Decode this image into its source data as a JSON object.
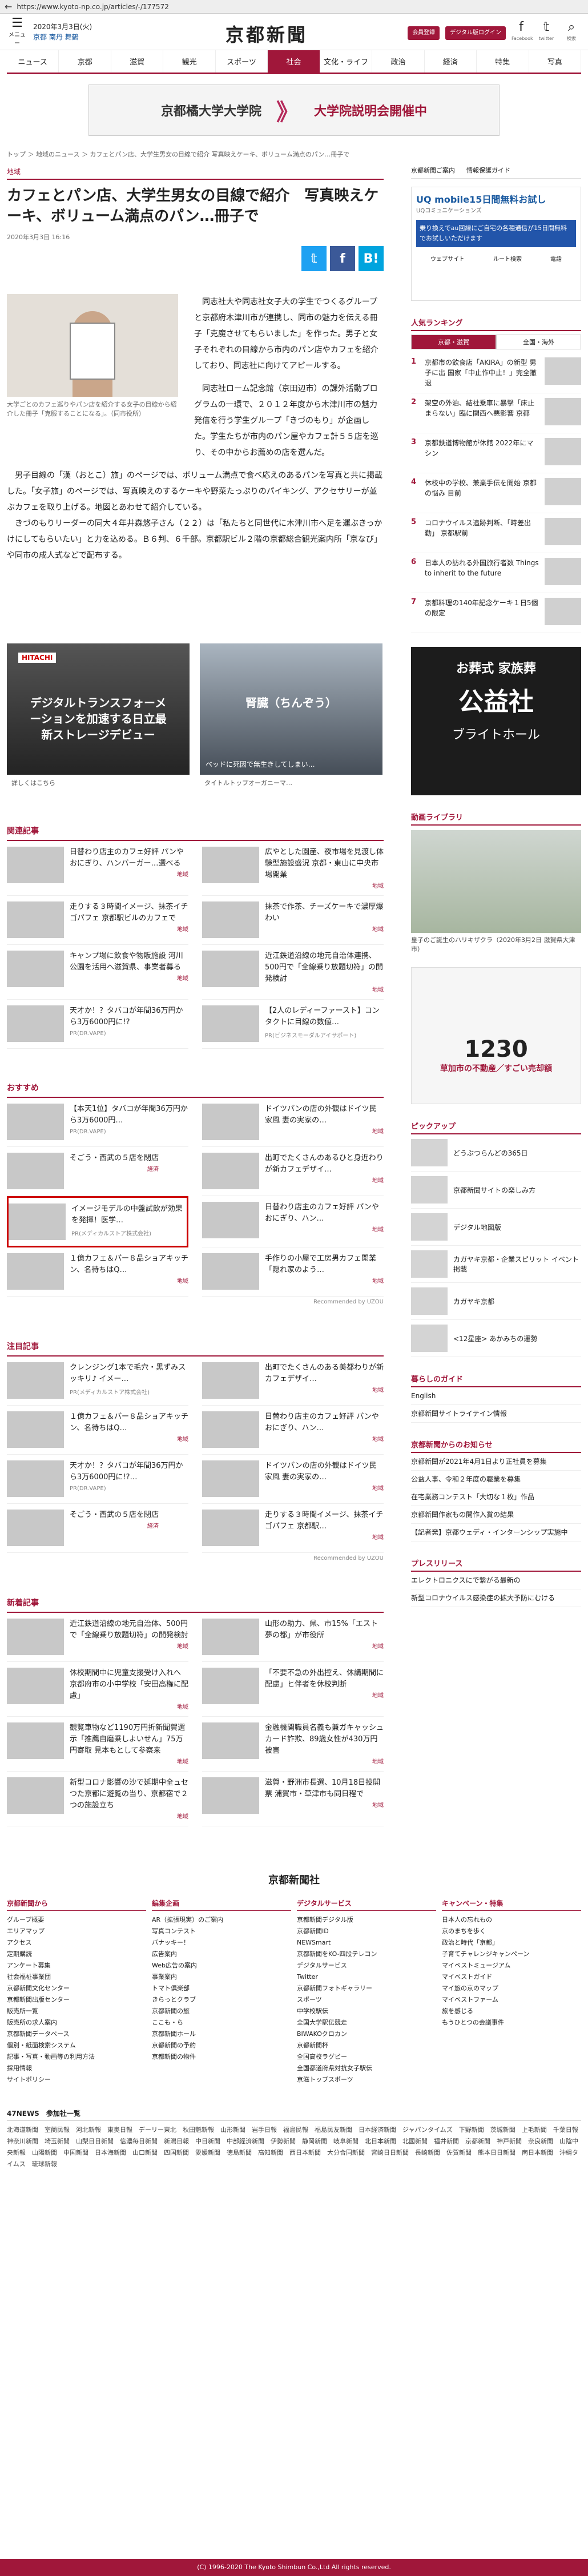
{
  "browser": {
    "url": "https://www.kyoto-np.co.jp/articles/-/177572"
  },
  "header": {
    "menu_label": "メニュー",
    "date": "2020年3月3日(火)",
    "weather": [
      "京都",
      "南丹",
      "舞鶴"
    ],
    "logo": "京都新聞",
    "btn_member": "会員登録",
    "btn_digital": "デジタル版ログイン",
    "facebook_label": "Facebook",
    "twitter_label": "twitter",
    "search_label": "検索"
  },
  "nav": [
    "ニュース",
    "京都",
    "滋賀",
    "観光",
    "スポーツ",
    "社会",
    "文化・ライフ",
    "政治",
    "経済",
    "特集",
    "写真"
  ],
  "banner": {
    "left": "京都橘大学大学院",
    "right": "大学院説明会開催中"
  },
  "breadcrumb": "トップ ＞ 地域のニュース ＞ カフェとパン店、大学生男女の目線で紹介 写真映えケーキ、ボリューム満点のパン…冊子で",
  "article": {
    "category": "地域",
    "title": "カフェとパン店、大学生男女の目線で紹介　写真映えケーキ、ボリューム満点のパン…冊子で",
    "date": "2020年3月3日 16:16",
    "caption": "大学ごとのカフェ巡りやパン店を紹介する女子の目線から紹介した冊子「克服することになる」。（同市役所）",
    "lead": "同志社大や同志社女子大の学生でつくるグループと京都府木津川市が連携し、同市の魅力を伝える冊子「克魔させてもらいました」を作った。男子と女子それぞれの目線から市内のパン店やカフェを紹介しており、同志社に向けてアピールする。",
    "para2": "同志社ローム記念館（京田辺市）の課外活動プログラムの一環で、２０１２年度から木津川市の魅力発信を行う学生グループ「きづのもり」が企画した。学生たちが市内のパン屋やカフェ計５５店を巡り、その中からお薦めの店を選んだ。",
    "para3": "男子目線の「漢（おとこ）旅」のページでは、ボリューム満点で食べ応えのあるパンを写真と共に掲載した。「女子旅」のページでは、写真映えのするケーキや野菜たっぷりのパイキング、アクセサリーが並ぶカフェを取り上げる。地図とあわせて紹介している。",
    "para4": "きづのもりリーダーの同大４年井森悠子さん（２２）は「私たちと同世代に木津川市へ足を運ぶきっかけにしてもらいたい」と力を込める。Ｂ６判、６千部。京都駅ビル２階の京都総合観光案内所「京なび」や同市の成人式などで配布する。"
  },
  "ads": {
    "ad1_brand": "HITACHI",
    "ad1_text": "デジタルトランスフォーメーションを加速する日立最新ストレージデビュー",
    "ad1_foot": "詳しくはこちら",
    "ad2_text": "腎臓（ちんぞう）",
    "ad2_sub": "ベッドに死因で無生きしてしまい…",
    "ad2_foot": "タイトルトップオーガニーマ…"
  },
  "related": {
    "title": "関連記事",
    "items": [
      {
        "text": "日替わり店主のカフェ好評 パンやおにぎり、ハンバーガー…選べる",
        "tag": "地域"
      },
      {
        "text": "広やとした園産、夜市場を見渡し体験型施設盛況 京都・東山に中央市場開業",
        "tag": "地域"
      },
      {
        "text": "走りする３時間イメージ、抹茶イチゴパフェ 京都駅ビルのカフェで",
        "tag": "地域"
      },
      {
        "text": "抹茶で作茶、チーズケーキで濃厚爆わい",
        "tag": "地域"
      },
      {
        "text": "キャンプ場に飲食や物販施設 河川公園を活用へ滋賀県、事業者募る",
        "tag": "地域"
      },
      {
        "text": "近江鉄道沿線の地元自治体連携、500円で「全線乗り放題切符」の開発検討",
        "tag": "地域"
      },
      {
        "text": "天才か！？タバコが年間36万円から3万6000円に!?",
        "tag": "PR(DR.VAPE)"
      },
      {
        "text": "【2人のレディーファースト】コンタクトに目線の数値…",
        "tag": "PR(ビジネスモーダルアイサポート)"
      }
    ]
  },
  "recommend": {
    "title": "おすすめ",
    "items": [
      {
        "text": "【本天1位】タバコが年間36万円から3万6000円…",
        "tag": "PR(DR.VAPE)"
      },
      {
        "text": "ドイツパンの店の外観はドイツ民家風 妻の実家の…",
        "tag": "地域"
      },
      {
        "text": "そごう・西武の５店を閉店",
        "tag": "経済"
      },
      {
        "text": "出町でたくさんのあるひと身近わりが新カフェデザイ…",
        "tag": "地域"
      },
      {
        "text": "イメージモデルの中盤試飲が効果を発揮！医学…",
        "tag": "PR(メディカルストア株式会社)"
      },
      {
        "text": "日替わり店主のカフェ好評 パンやおにぎり、ハン…",
        "tag": "地域"
      },
      {
        "text": "１億カフェ＆パー８品ショアキッチン、名待ちはQ…",
        "tag": "地域"
      },
      {
        "text": "手作りの小屋で工房男カフェ開業 「隠れ家のよう…",
        "tag": "地域"
      }
    ],
    "footer": "Recommended by UZOU"
  },
  "notable": {
    "title": "注目記事",
    "items": [
      {
        "text": "クレンジング1本で毛穴・黒ずみスッキリ♪ イメー…",
        "tag": "PR(メディカルストア株式会社)"
      },
      {
        "text": "出町でたくさんのある美都わりが新カフェデザイ…",
        "tag": "地域"
      },
      {
        "text": "１億カフェ＆パー８品ショアキッチン、名待ちはQ…",
        "tag": "地域"
      },
      {
        "text": "日替わり店主のカフェ好評 パンやおにぎり、ハン…",
        "tag": "地域"
      },
      {
        "text": "天才か！？タバコが年間36万円から3万6000円に!?…",
        "tag": "PR(DR.VAPE)"
      },
      {
        "text": "ドイツパンの店の外観はドイツ民家風 妻の実家の…",
        "tag": "地域"
      },
      {
        "text": "そごう・西武の５店を閉店",
        "tag": "経済"
      },
      {
        "text": "走りする３時間イメージ、抹茶イチゴパフェ 京都駅…",
        "tag": "地域"
      }
    ],
    "footer": "Recommended by UZOU"
  },
  "latest": {
    "title": "新着記事",
    "items": [
      {
        "text": "近江鉄道沿線の地元自治体、500円で「全線乗り放題切符」の開発検討",
        "tag": "地域"
      },
      {
        "text": "山形の助力、県、市15%「エスト夢の都」が市役所",
        "tag": "地域"
      },
      {
        "text": "休校期間中に児童支援受け入れへ 京都府市の小中学校「安田高権に配慮」",
        "tag": "地域"
      },
      {
        "text": "「不要不急の外出控え、休講期間に配慮」ヒ伴者を休校判断",
        "tag": "地域"
      },
      {
        "text": "観覧車物など1190万円折新聞賀選示「推薦自磨乗しよいせん」75万円寄取 見本もとして参察来",
        "tag": "地域"
      },
      {
        "text": "金融機関職員名義も兼ガキャッシュカード詐欺、89歳女性が430万円被害",
        "tag": "地域"
      },
      {
        "text": "新型コロナ影響の沙で延期中全ュセつた京都に遊覧の当り、京都宿で２つの施設立ち",
        "tag": "地域"
      },
      {
        "text": "滋賀・野洲市長選、10月18日投開票 浦賀市・草津市も同日程で",
        "tag": "地域"
      }
    ]
  },
  "sidebar": {
    "links": [
      "京都新聞ご案内",
      "情報保護ガイド"
    ],
    "ad_title": "UQ mobile15日間無料お試し",
    "ad_sub": "UQコミュニケーションズ",
    "ad_body": "乗り換えでau回線にご自宅の各種通信が15日間無料でお試しいただけます",
    "ad_btns": [
      "ウェブサイト",
      "ルート検索",
      "電話"
    ],
    "ranking_title": "人気ランキング",
    "ranking_tabs": [
      "京都・滋賀",
      "全国・海外"
    ],
    "ranking": [
      {
        "n": "1",
        "text": "京都市の飲食店「AKIRA」の新型 男子に出 国家「中止作中止！」完全撤退"
      },
      {
        "n": "2",
        "text": "架空の外泊、結社乗車に暴撃「床止まらない」臨に関西へ悪影響 京都"
      },
      {
        "n": "3",
        "text": "京都鉄道博物館が休館 2022年にマシン"
      },
      {
        "n": "4",
        "text": "休校中の学校、兼業手伝を開始 京都の悩み 目前"
      },
      {
        "n": "5",
        "text": "コロナウイルス追跡判断、「時差出勤」 京都駅前"
      },
      {
        "n": "6",
        "text": "日本人の訪れる外国旅行者数 Things to inherit to the future"
      },
      {
        "n": "7",
        "text": "京都料理の140年記念ケーキ１日5個の限定"
      }
    ],
    "ad2": [
      "お葬式 家族葬",
      "公益社",
      "ブライトホール"
    ],
    "video_title": "動画ライブラリ",
    "video_caption": "皇子のご誕生のハリキザクラ（2020年3月2日 滋賀県大津市）",
    "ad3_num": "1230",
    "ad3_sub": "草加市の不動産／すごい売却額",
    "pickup_title": "ピックアップ",
    "pickup": [
      "どうぶつらんどの365日",
      "京都新聞サイトの楽しみ方",
      "デジタル地図版",
      "カガヤキ京都・企業スピリット イベント掲載",
      "カガヤキ京都",
      "<12星座> あかみちの運勢"
    ],
    "guide_title": "暮らしのガイド",
    "guide": [
      "English",
      "京都新聞サイトライテイン情報"
    ],
    "notice_title": "京都新聞からのお知らせ",
    "notice": [
      "京都新聞が2021年4月1日より正社員を募集",
      "公益人事、令和２年度の職業を募集",
      "在宅業務コンテスト「大切な１枚」作品",
      "京都新聞作家もの開作入賞の結果",
      "【記者発】京都ウェディ・インターンシップ実施中"
    ],
    "press_title": "プレスリリース",
    "press": [
      "エレクトロニクスにで繋がる最新の",
      "新型コロナウイルス感染症の拡大予防にむける"
    ]
  },
  "footer": {
    "logo": "京都新聞社",
    "cols": [
      {
        "title": "京都新聞から",
        "items": [
          "グループ概要",
          "エリアマップ",
          "アクセス",
          "定期購読",
          "アンケート募集",
          "社会福祉事業団",
          "京都新聞文化センター",
          "京都新聞出版センター",
          "販売所一覧",
          "販売所の求人案内",
          "京都新聞データベース",
          "個別・紙面検索システム",
          "記事・写真・動画等の利用方法",
          "採用情報",
          "サイトポリシー"
        ]
      },
      {
        "title": "編集企画",
        "items": [
          "AR（拡張現実）のご案内",
          "写真コンテスト",
          "バナッキー！",
          "広告案内",
          "Web広告の案内",
          "事業案内",
          "トマト倶楽部",
          "きらっとクラブ",
          "京都新聞の旅",
          "ここも・ら",
          "京都新聞ホール",
          "京都新聞の予約",
          "京都新聞の物件"
        ]
      },
      {
        "title": "デジタルサービス",
        "items": [
          "京都新聞デジタル版",
          "京都新聞ID",
          "NEWSmart",
          "京都新聞をKO-四段テレコン",
          "デジタルサービス",
          "Twitter",
          "京都新聞フォトギャラリー",
          "スポーツ",
          "中学校駅伝",
          "全国大学駅伝競走",
          "BIWAKOクロカン",
          "京都新聞杯",
          "全国高校ラグビー",
          "全国都道府県対抗女子駅伝",
          "京滋トップスポーツ"
        ]
      },
      {
        "title": "キャンペーン・特集",
        "items": [
          "日本人の忘れもの",
          "京のまちを歩く",
          "政治と時代「京都」",
          "子育てチャレンジキャンペーン",
          "マイベストミュージアム",
          "マイベストガイド",
          "マイ旅の京のマップ",
          "マイベストファーム",
          "旅を感じる",
          "もうひとつの会議事件"
        ]
      }
    ],
    "network_title": "47NEWS　参加社一覧",
    "network": "北海道新聞　室蘭民報　河北新報　東奥日報　デーリー東北　秋田魁新報　山形新聞　岩手日報　福島民報　福島民友新聞　日本経済新聞　ジャパンタイムズ　下野新聞　茨城新聞　上毛新聞　千葉日報　神奈川新聞　埼玉新聞　山梨日日新聞　信濃毎日新聞　新潟日報　中日新聞　中部経済新聞　伊勢新聞　静岡新聞　岐阜新聞　北日本新聞　北國新聞　福井新聞　京都新聞　神戸新聞　奈良新聞　山陰中央新報　山陽新聞　中国新聞　日本海新聞　山口新聞　四国新聞　愛媛新聞　徳島新聞　高知新聞　西日本新聞　大分合同新聞　宮崎日日新聞　長崎新聞　佐賀新聞　熊本日日新聞　南日本新聞　沖縄タイムス　琉球新報",
    "copyright": "(C) 1996-2020 The Kyoto Shimbun Co.,Ltd All rights reserved."
  },
  "colors": {
    "brand": "#a0173a",
    "facebook": "#3b5998",
    "twitter": "#1da1f2",
    "hatena": "#00a4de"
  }
}
